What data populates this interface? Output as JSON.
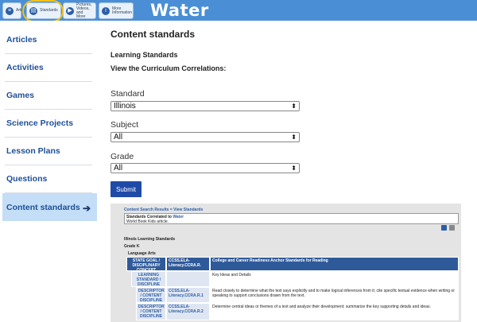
{
  "topbar": {
    "brand": "Water",
    "tabs": [
      {
        "label": "Artic",
        "icon": "article-icon"
      },
      {
        "label": "Standards",
        "icon": "clipboard-icon"
      },
      {
        "label": "Pictures, Videos, and More",
        "icon": "media-icon"
      },
      {
        "label": "More Information",
        "icon": "info-icon"
      }
    ],
    "highlight_color": "#f2c21a",
    "bar_color": "#4a8fd6"
  },
  "sidebar": {
    "items": [
      {
        "label": "Articles"
      },
      {
        "label": "Activities"
      },
      {
        "label": "Games"
      },
      {
        "label": "Science Projects"
      },
      {
        "label": "Lesson Plans"
      },
      {
        "label": "Questions"
      },
      {
        "label": "Content standards",
        "active": true
      }
    ],
    "active_arrow": "➔"
  },
  "main": {
    "title": "Content standards",
    "learning_standards": "Learning Standards",
    "view_correlations": "View the Curriculum Correlations:",
    "standard": {
      "label": "Standard",
      "value": "Illinois"
    },
    "subject": {
      "label": "Subject",
      "value": "All"
    },
    "grade": {
      "label": "Grade",
      "value": "All"
    },
    "submit_label": "Submit"
  },
  "results": {
    "breadcrumb": "Content Search Results = View Standards",
    "correlated_prefix": "Standards Correlated to",
    "correlated_link": "Water",
    "article_note": "World Book Kids article.",
    "heading": "Illinois Learning Standards",
    "grade": "Grade K",
    "subject": "Language Arts",
    "rows": [
      {
        "c1": "STATE GOAL / DISCIPLINARY CONCEPT",
        "c2": "CCSS.ELA-Literacy.CCRA.R.",
        "c3": "College and Career Readiness Anchor Standards for Reading"
      },
      {
        "c1": "LEARNING STANDARD / DISCIPLINE",
        "c2": "",
        "c3": "Key Ideas and Details"
      },
      {
        "c1": "DESCRIPTOR / CONTENT DISCIPLINE",
        "c2": "CCSS.ELA-Literacy.CCRA.R.1",
        "c3": "Read closely to determine what the text says explicitly and to make logical inferences from it; cite specific textual evidence when writing or speaking to support conclusions drawn from the text."
      },
      {
        "c1": "DESCRIPTOR / CONTENT DISCIPLINE",
        "c2": "CCSS.ELA-Literacy.CCRA.R.2",
        "c3": "Determine central ideas or themes of a text and analyze their development; summarize the key supporting details and ideas."
      }
    ]
  }
}
